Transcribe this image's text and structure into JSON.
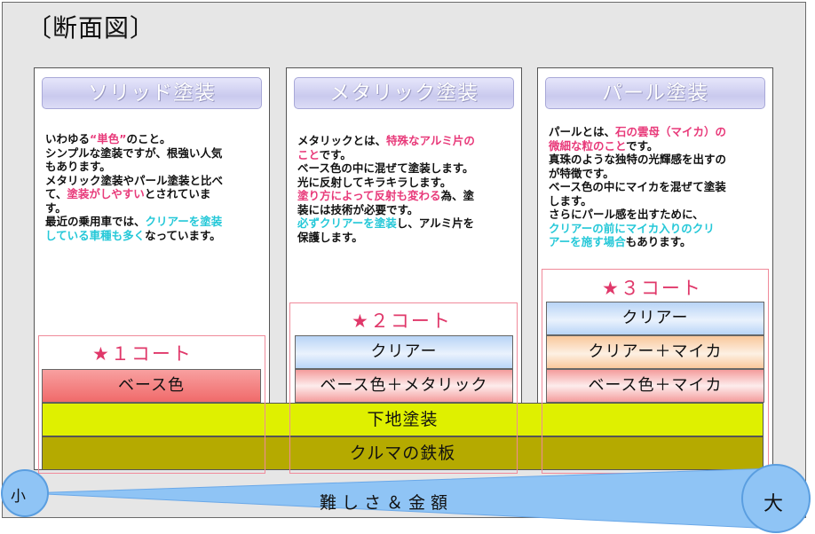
{
  "page_title": "〔断面図〕",
  "columns": [
    {
      "title": "ソリッド塗装",
      "desc": [
        [
          {
            "t": "いわゆる"
          },
          {
            "t": "“単色”",
            "c": "pink"
          },
          {
            "t": "のこと。"
          }
        ],
        [
          {
            "t": "シンプルな塗装ですが、根強い人気"
          }
        ],
        [
          {
            "t": "もあります。"
          }
        ],
        [
          {
            "t": "メタリック塗装やパール塗装と比べ"
          }
        ],
        [
          {
            "t": "て、"
          },
          {
            "t": "塗装がしやすい",
            "c": "pink"
          },
          {
            "t": "とされていま"
          }
        ],
        [
          {
            "t": "す。"
          }
        ],
        [
          {
            "t": "最近の乗用車では、"
          },
          {
            "t": "クリアーを塗装",
            "c": "cyan"
          }
        ],
        [
          {
            "t": "している車種も多く",
            "c": "cyan"
          },
          {
            "t": "なっています。"
          }
        ]
      ],
      "coat_title": "★１コート",
      "layers": [
        "ベース色"
      ]
    },
    {
      "title": "メタリック塗装",
      "desc": [
        [
          {
            "t": "メタリックとは、"
          },
          {
            "t": "特殊なアルミ片の",
            "c": "pink"
          }
        ],
        [
          {
            "t": "こと",
            "c": "pink"
          },
          {
            "t": "です。"
          }
        ],
        [
          {
            "t": "ベース色の中に混ぜて塗装します。"
          }
        ],
        [
          {
            "t": "光に反射してキラキラします。"
          }
        ],
        [
          {
            "t": "塗り方によって反射も変わる",
            "c": "pink"
          },
          {
            "t": "為、塗"
          }
        ],
        [
          {
            "t": "装には技術が必要です。"
          }
        ],
        [
          {
            "t": "必ずクリアーを塗装",
            "c": "cyan"
          },
          {
            "t": "し、アルミ片を"
          }
        ],
        [
          {
            "t": "保護します。"
          }
        ]
      ],
      "coat_title": "★２コート",
      "layers": [
        "クリアー",
        "ベース色＋メタリック"
      ]
    },
    {
      "title": "パール塗装",
      "desc": [
        [
          {
            "t": "パールとは、"
          },
          {
            "t": "石の雲母（マイカ）の",
            "c": "pink"
          }
        ],
        [
          {
            "t": "微細な粒のこと",
            "c": "pink"
          },
          {
            "t": "です。"
          }
        ],
        [
          {
            "t": "真珠のような独特の光輝感を出すの"
          }
        ],
        [
          {
            "t": "が特徴です。"
          }
        ],
        [
          {
            "t": "ベース色の中にマイカを混ぜて塗装"
          }
        ],
        [
          {
            "t": "します。"
          }
        ],
        [
          {
            "t": "さらにパール感を出すために、"
          }
        ],
        [
          {
            "t": "クリアーの前にマイカ入りのクリ",
            "c": "cyan"
          }
        ],
        [
          {
            "t": "アーを施す場合",
            "c": "cyan"
          },
          {
            "t": "もあります。"
          }
        ]
      ],
      "coat_title": "★３コート",
      "layers": [
        "クリアー",
        "クリアー＋マイカ",
        "ベース色＋マイカ"
      ]
    }
  ],
  "shared_layers": {
    "primer": "下地塗装",
    "steel": "クルマの鉄板"
  },
  "scale": {
    "label": "難しさ＆金額",
    "small": "小",
    "large": "大"
  },
  "colors": {
    "pink": "#e83a7a",
    "cyan": "#25c8d8",
    "primer": "#dff000",
    "steel": "#b5aa00",
    "scale": "#8fc4f5"
  }
}
